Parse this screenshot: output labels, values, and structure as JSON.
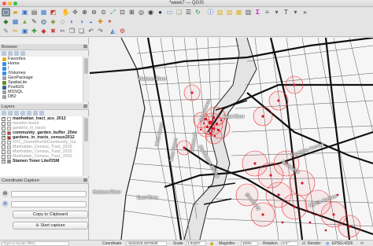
{
  "window": {
    "title": "*week7 — QGIS"
  },
  "browser_panel": {
    "title": "Browser",
    "items": [
      {
        "label": "Favorites",
        "icon": "star-icon",
        "color": "#e6b422"
      },
      {
        "label": "Home",
        "icon": "folder-icon",
        "color": "#3a8ee6"
      },
      {
        "label": "/",
        "icon": "folder-icon",
        "color": "#3a8ee6"
      },
      {
        "label": "/Volumes",
        "icon": "folder-icon",
        "color": "#3a8ee6"
      },
      {
        "label": "GeoPackage",
        "icon": "geopackage-icon",
        "color": "#9aa0a6"
      },
      {
        "label": "SpatiaLite",
        "icon": "spatialite-icon",
        "color": "#6b8e23"
      },
      {
        "label": "PostGIS",
        "icon": "postgis-icon",
        "color": "#336791"
      },
      {
        "label": "MSSQL",
        "icon": "mssql-icon",
        "color": "#9aa0a6"
      },
      {
        "label": "DB2",
        "icon": "db2-icon",
        "color": "#9aa0a6"
      }
    ]
  },
  "layers_panel": {
    "title": "Layers",
    "items": [
      {
        "label": "manhattan_tract_acs_2012",
        "checked": true,
        "style": "bold",
        "swatch": "#ffffff"
      },
      {
        "label": "maxdon buont",
        "checked": false,
        "style": "dim",
        "swatch": "#dddddd"
      },
      {
        "label": "gardens_in_tracts",
        "checked": false,
        "style": "dim",
        "swatch": "#dddddd"
      },
      {
        "label": "community_garden_buffer_25mi",
        "checked": true,
        "style": "bold",
        "swatch": "#e0303a"
      },
      {
        "label": "gardens_in_tracts_census2012",
        "checked": true,
        "style": "bold",
        "swatch": "#cc2222"
      },
      {
        "label": "NYC_GreenthumbCommunity_Ga",
        "checked": false,
        "style": "dim",
        "swatch": "#dddddd"
      },
      {
        "label": "Manhattan_Census_Tract_2010",
        "checked": false,
        "style": "dim",
        "swatch": "#dddddd"
      },
      {
        "label": "Manhattan_Census_Tract_2010",
        "checked": false,
        "style": "dim",
        "swatch": "#dddddd"
      },
      {
        "label": "Manhattan_Census_Tract_2010",
        "checked": false,
        "style": "dim",
        "swatch": "#dddddd"
      },
      {
        "label": "Stamen Toner Lite/OSM",
        "checked": true,
        "style": "bold",
        "swatch": "#888888"
      }
    ]
  },
  "coordinate_capture": {
    "title": "Coordinate Capture",
    "copy_button": "Copy to Clipboard",
    "start_button": "Start capture"
  },
  "map": {
    "labels": [
      "Hudson River",
      "West Street",
      "3rd Avenue",
      "West Street",
      "Avenue D",
      "East River",
      "Manhattan Bridge",
      "Broadway",
      "Bushwick",
      "Flushing Avenue",
      "Myrtle Avenue",
      "Hudson River",
      "East River"
    ]
  },
  "status_bar": {
    "search_placeholder": "Type to locate (⌘K)",
    "coordinate_label": "Coordinate",
    "coordinate_value": "-8242229,4970025",
    "scale_label": "Scale",
    "scale_value": "1:94207",
    "magnifier_label": "Magnifier",
    "magnifier_value": "100%",
    "rotation_label": "Rotation",
    "rotation_value": "0.0 °",
    "render_label": "Render",
    "crs_label": "EPSG:4326"
  }
}
